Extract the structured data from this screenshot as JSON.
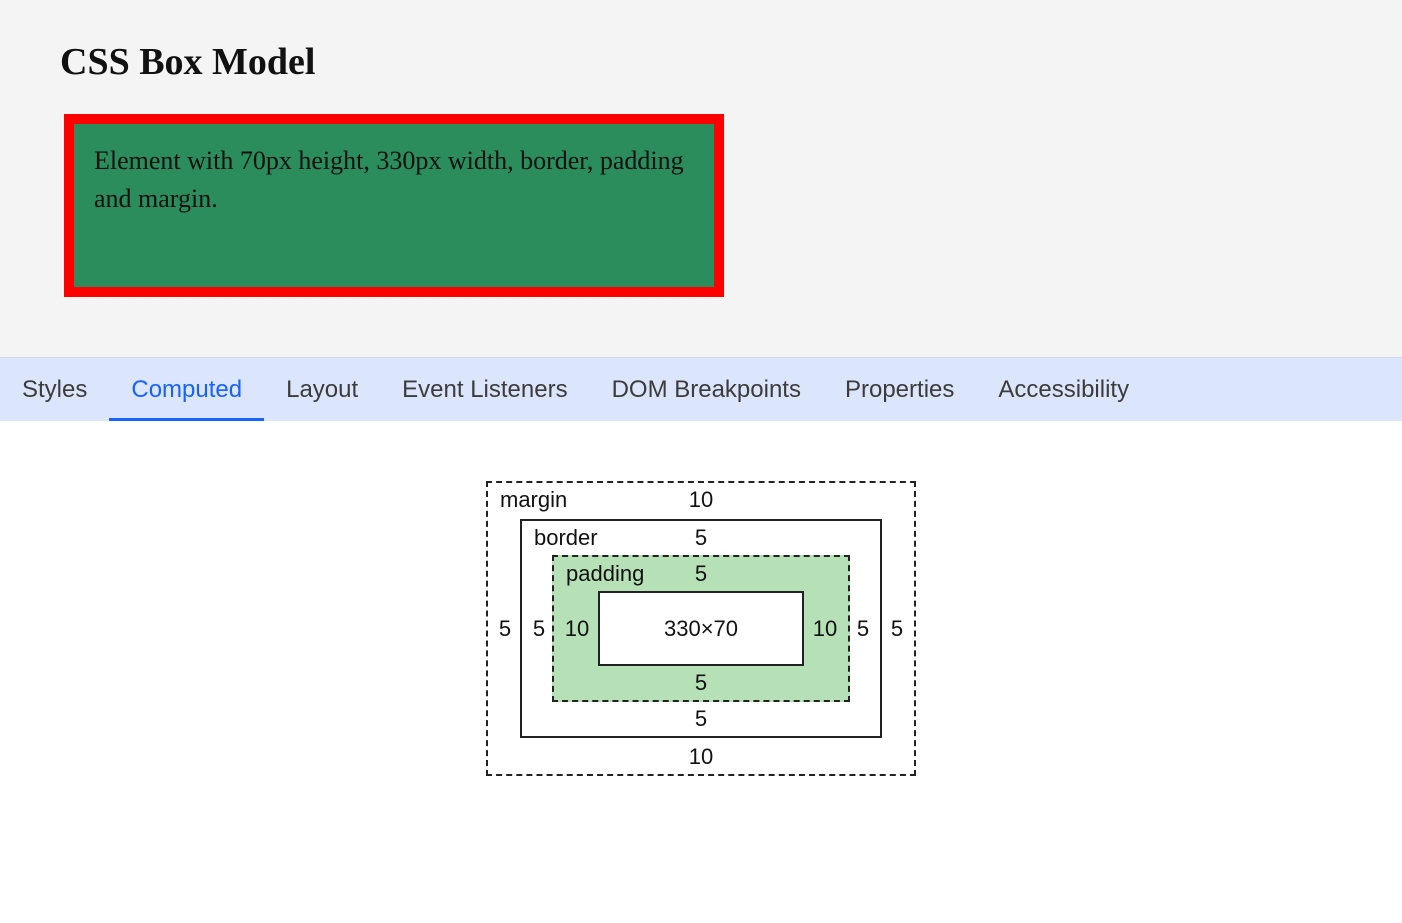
{
  "heading": "CSS Box Model",
  "sample_text": "Element with 70px height, 330px width, border, padding and margin.",
  "devtools_tabs": {
    "styles": "Styles",
    "computed": "Computed",
    "layout": "Layout",
    "event_listeners": "Event Listeners",
    "dom_breakpoints": "DOM Breakpoints",
    "properties": "Properties",
    "accessibility": "Accessibility"
  },
  "box_model": {
    "margin": {
      "label": "margin",
      "top": "10",
      "right": "5",
      "bottom": "10",
      "left": "5"
    },
    "border": {
      "label": "border",
      "top": "5",
      "right": "5",
      "bottom": "5",
      "left": "5"
    },
    "padding": {
      "label": "padding",
      "top": "5",
      "right": "10",
      "bottom": "5",
      "left": "10"
    },
    "content": "330×70"
  }
}
